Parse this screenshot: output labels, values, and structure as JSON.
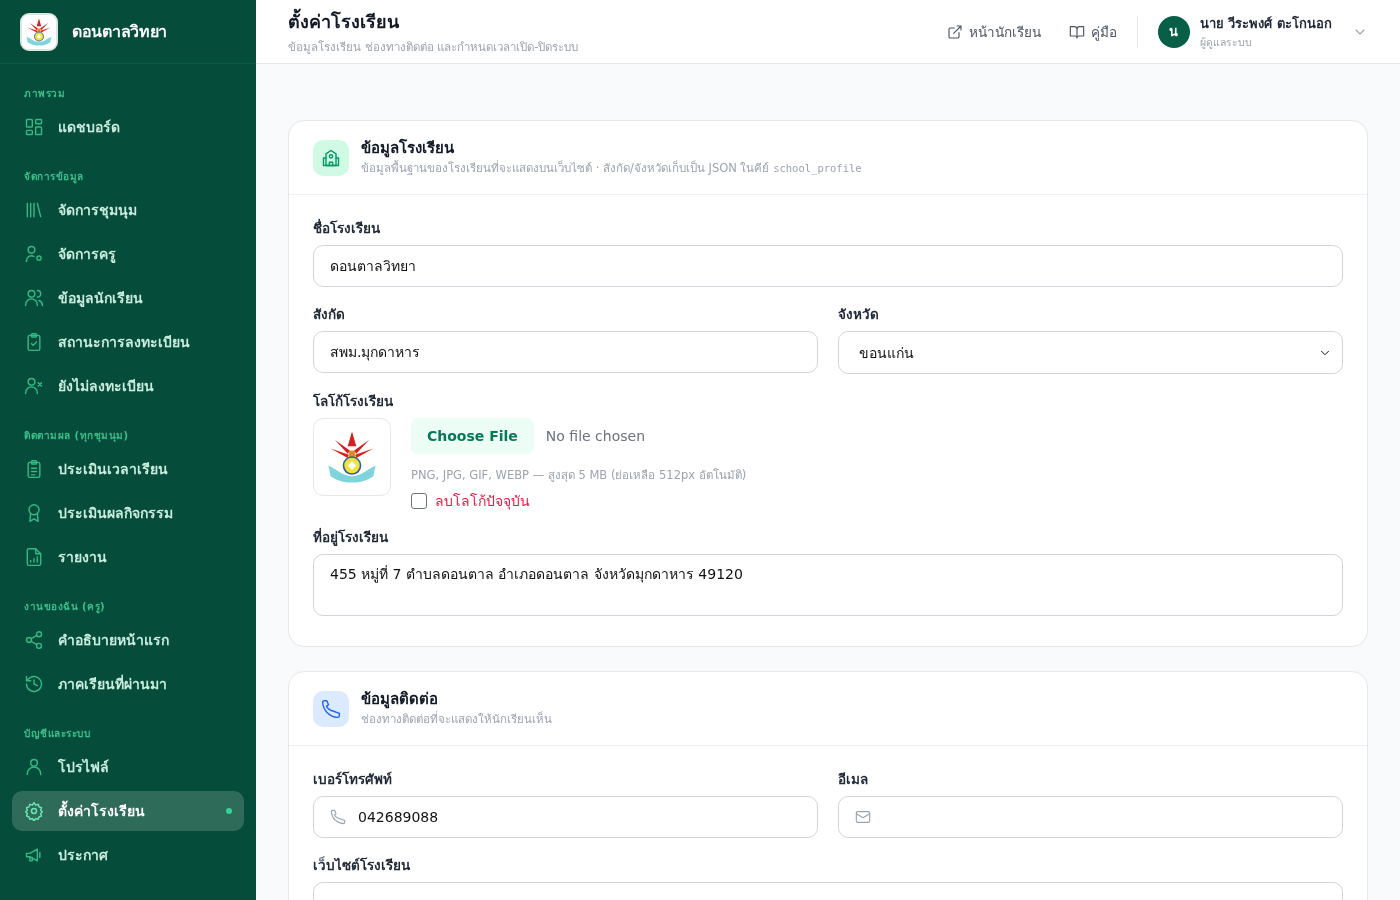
{
  "sidebar": {
    "brand": "ดอนตาลวิทยา",
    "sections": [
      {
        "title": "ภาพรวม",
        "items": [
          {
            "label": "แดชบอร์ด",
            "selected": false
          }
        ]
      },
      {
        "title": "จัดการข้อมูล",
        "items": [
          {
            "label": "จัดการชุมนุม",
            "selected": false
          },
          {
            "label": "จัดการครู",
            "selected": false
          },
          {
            "label": "ข้อมูลนักเรียน",
            "selected": false
          },
          {
            "label": "สถานะการลงทะเบียน",
            "selected": false
          },
          {
            "label": "ยังไม่ลงทะเบียน",
            "selected": false
          }
        ]
      },
      {
        "title": "ติดตามผล (ทุกชุมนุม)",
        "items": [
          {
            "label": "ประเมินเวลาเรียน",
            "selected": false
          },
          {
            "label": "ประเมินผลกิจกรรม",
            "selected": false
          },
          {
            "label": "รายงาน",
            "selected": false
          }
        ]
      },
      {
        "title": "งานของฉัน (ครู)",
        "items": [
          {
            "label": "คำอธิบายหน้าแรก",
            "selected": false
          },
          {
            "label": "ภาคเรียนที่ผ่านมา",
            "selected": false
          }
        ]
      },
      {
        "title": "บัญชีและระบบ",
        "items": [
          {
            "label": "โปรไฟล์",
            "selected": false
          },
          {
            "label": "ตั้งค่าโรงเรียน",
            "selected": true
          },
          {
            "label": "ประกาศ",
            "selected": false
          }
        ]
      }
    ]
  },
  "header": {
    "title": "ตั้งค่าโรงเรียน",
    "subtitle": "ข้อมูลโรงเรียน ช่องทางติดต่อ และกำหนดเวลาเปิด-ปิดระบบ",
    "links": [
      {
        "label": "หน้านักเรียน"
      },
      {
        "label": "คู่มือ"
      }
    ],
    "user": {
      "initial": "น",
      "name": "นาย วีระพงศ์ ตะโกนอก",
      "role": "ผู้ดูแลระบบ"
    }
  },
  "cards": [
    {
      "title": "ข้อมูลโรงเรียน",
      "subtitle": "ข้อมูลพื้นฐานของโรงเรียนที่จะแสดงบนเว็บไซต์ · สังกัด/จังหวัดเก็บเป็น JSON ในคีย์",
      "subtitle_code": "school_profile",
      "rows": [
        [
          {
            "kind": "text",
            "label": "ชื่อโรงเรียน",
            "value": "ดอนตาลวิทยา"
          }
        ],
        [
          {
            "kind": "text",
            "label": "สังกัด",
            "value": "สพม.มุกดาหาร"
          },
          {
            "kind": "select",
            "label": "จังหวัด",
            "value": "ขอนแก่น"
          }
        ],
        [
          {
            "kind": "file",
            "label": "โลโก้โรงเรียน",
            "button": "Choose File",
            "status": "No file chosen",
            "hint": "PNG, JPG, GIF, WEBP — สูงสุด 5 MB (ย่อเหลือ 512px อัตโนมัติ)",
            "remove_label": "ลบโลโก้ปัจจุบัน",
            "remove_checked": false
          }
        ],
        [
          {
            "kind": "textarea",
            "label": "ที่อยู่โรงเรียน",
            "value": "455 หมู่ที่ 7 ตำบลดอนตาล อำเภอดอนตาล จังหวัดมุกดาหาร 49120"
          }
        ]
      ]
    },
    {
      "title": "ข้อมูลติดต่อ",
      "subtitle": "ช่องทางติดต่อที่จะแสดงให้นักเรียนเห็น",
      "rows": [
        [
          {
            "kind": "phone",
            "label": "เบอร์โทรศัพท์",
            "value": "042689088"
          },
          {
            "kind": "email",
            "label": "อีเมล"
          }
        ],
        [
          {
            "kind": "text",
            "label": "เว็บไซต์โรงเรียน"
          }
        ]
      ]
    }
  ]
}
